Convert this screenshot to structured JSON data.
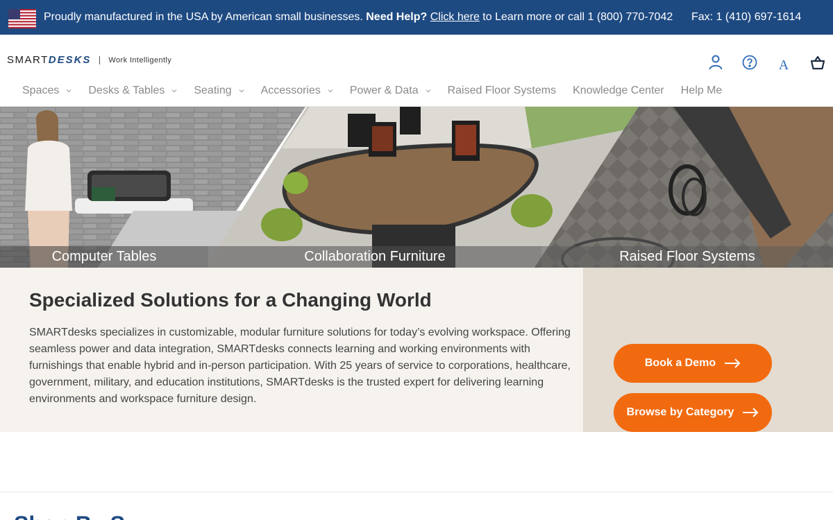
{
  "topbar": {
    "flag_icon": "us-flag-icon",
    "msg_prefix": "Proudly manufactured in the USA by American small businesses.",
    "need_help": "Need Help?",
    "click_here": "Click here",
    "msg_suffix": "to Learn more or call 1 (800) 770-7042",
    "fax": "Fax: 1 (410) 697-1614",
    "bg_color": "#1e4a82"
  },
  "header": {
    "brand_plain": "SMART",
    "brand_accent": "DESKS",
    "tagline": "Work Intelligently",
    "icons": [
      "account-icon",
      "help-circle-icon",
      "font-size-icon",
      "cart-icon"
    ],
    "font_icon_glyph": "A"
  },
  "nav": [
    {
      "label": "Spaces",
      "dropdown": true
    },
    {
      "label": "Desks & Tables",
      "dropdown": true
    },
    {
      "label": "Seating",
      "dropdown": true
    },
    {
      "label": "Accessories",
      "dropdown": true
    },
    {
      "label": "Power & Data",
      "dropdown": true
    },
    {
      "label": "Raised Floor Systems",
      "dropdown": false
    },
    {
      "label": "Knowledge Center",
      "dropdown": false
    },
    {
      "label": "Help Me",
      "dropdown": false
    }
  ],
  "hero": [
    {
      "label": "Computer Tables"
    },
    {
      "label": "Collaboration Furniture"
    },
    {
      "label": "Raised Floor Systems"
    }
  ],
  "intro": {
    "title": "Specialized Solutions for a Changing World",
    "body": "SMARTdesks specializes in customizable, modular furniture solutions for today’s evolving workspace. Offering seamless power and data integration, SMARTdesks connects learning and working environments with furnishings that enable hybrid and in-person participation. With 25 years of service to corporations, healthcare, government, military, and education institutions, SMARTdesks is the trusted expert for delivering learning environments and workspace furniture design."
  },
  "cta": {
    "demo": "Book a Demo",
    "browse": "Browse by Category",
    "color": "#f26a0f"
  },
  "shop": {
    "heading": "Shop By S"
  }
}
